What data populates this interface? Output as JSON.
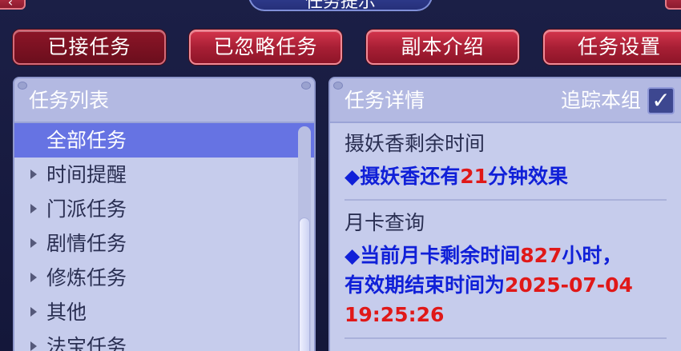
{
  "header": {
    "title": "任务提示"
  },
  "tabs": [
    {
      "label": "已接任务",
      "active": true
    },
    {
      "label": "已忽略任务",
      "active": false
    },
    {
      "label": "副本介绍",
      "active": false
    },
    {
      "label": "任务设置",
      "active": false
    }
  ],
  "task_list": {
    "title": "任务列表",
    "items": [
      {
        "label": "全部任务",
        "selected": true
      },
      {
        "label": "时间提醒"
      },
      {
        "label": "门派任务"
      },
      {
        "label": "剧情任务"
      },
      {
        "label": "修炼任务"
      },
      {
        "label": "其他"
      },
      {
        "label": "法宝任务"
      }
    ]
  },
  "details": {
    "title": "任务详情",
    "track_label": "追踪本组",
    "track_checked": true,
    "check_glyph": "✓",
    "sections": [
      {
        "title": "摄妖香剩余时间",
        "line1": {
          "prefix": "◆摄妖香还有",
          "value": "21",
          "suffix": "分钟效果"
        }
      },
      {
        "title": "月卡查询",
        "line1": {
          "prefix": "◆当前月卡剩余时间",
          "value": "827",
          "suffix": "小时，"
        },
        "line2": {
          "prefix": "有效期结束时间为",
          "value": "2025-07-04"
        },
        "line3": {
          "value": "19:25:26"
        }
      }
    ]
  },
  "colors": {
    "tab_red": "#a81f35",
    "panel_bg": "#c6ccec",
    "selected_row": "#6673e3",
    "info_blue": "#1020d8",
    "value_red": "#e01818"
  }
}
